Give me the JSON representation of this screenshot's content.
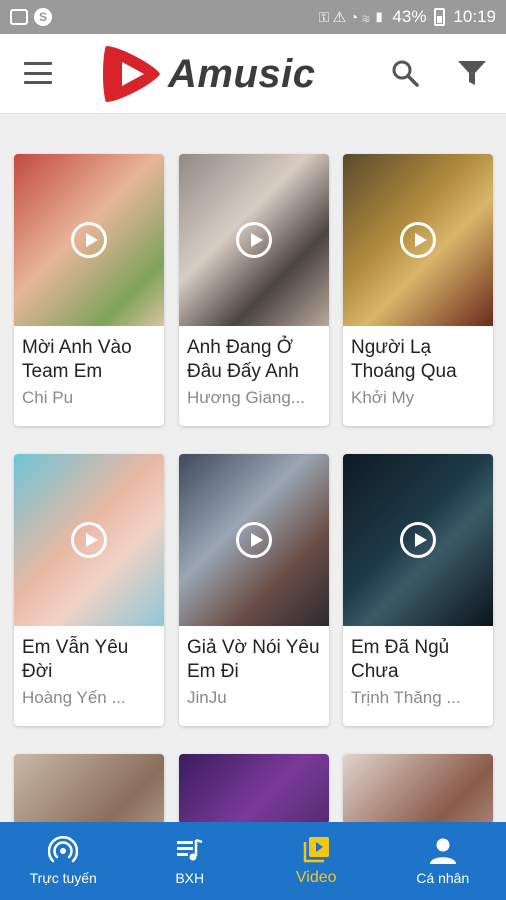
{
  "status_bar": {
    "battery": "43%",
    "time": "10:19"
  },
  "app": {
    "name": "Amusic"
  },
  "videos": [
    {
      "title": "Mời Anh Vào Team Em",
      "artist": "Chi Pu"
    },
    {
      "title": "Anh Đang Ở Đâu Đấy Anh",
      "artist": "Hương Giang..."
    },
    {
      "title": "Người Lạ Thoáng Qua",
      "artist": "Khởi My"
    },
    {
      "title": "Em Vẫn Yêu Đời",
      "artist": "Hoàng Yến ..."
    },
    {
      "title": "Giả Vờ Nói Yêu Em Đi",
      "artist": "JinJu"
    },
    {
      "title": "Em Đã Ngủ Chưa",
      "artist": "Trịnh Thăng ..."
    }
  ],
  "bottom_nav": [
    {
      "label": "Trực tuyến",
      "icon": "broadcast-icon"
    },
    {
      "label": "BXH",
      "icon": "playlist-icon"
    },
    {
      "label": "Video",
      "icon": "video-library-icon"
    },
    {
      "label": "Cá nhân",
      "icon": "person-icon"
    }
  ],
  "colors": {
    "brand_red": "#d8232a",
    "nav_blue": "#1e74c8",
    "active": "#f5c518"
  }
}
